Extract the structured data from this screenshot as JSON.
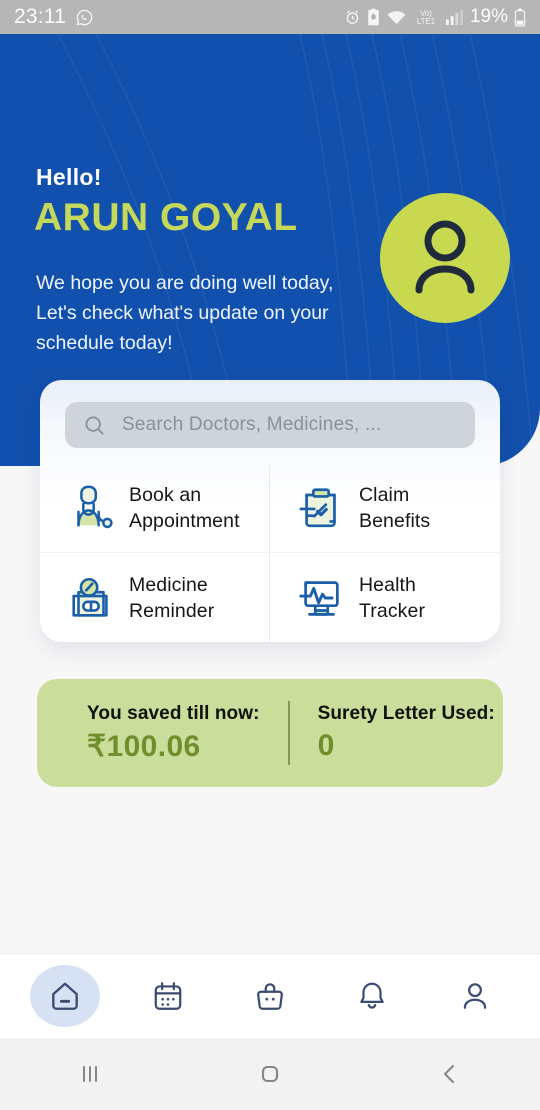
{
  "statusbar": {
    "time": "23:11",
    "battery_percent": "19%",
    "icons": [
      "whatsapp-icon",
      "alarm-icon",
      "battery-saver-icon",
      "wifi-icon",
      "volte-icon",
      "signal-icon",
      "battery-icon"
    ]
  },
  "header": {
    "greeting": "Hello!",
    "username": "ARUN GOYAL",
    "subtitle": "We hope you are doing well today, Let's check what's update on your schedule today!",
    "avatar_alt": "user-avatar",
    "bg_color": "#1250ad",
    "name_color": "#c5d85a",
    "avatar_color": "#c8d94f"
  },
  "search": {
    "placeholder": "Search Doctors, Medicines, ...",
    "value": ""
  },
  "quick_actions": [
    {
      "label": "Book an\nAppointment",
      "icon": "doctor-icon"
    },
    {
      "label": "Claim\nBenefits",
      "icon": "clipboard-check-icon"
    },
    {
      "label": "Medicine\nReminder",
      "icon": "medicine-clock-icon"
    },
    {
      "label": "Health\nTracker",
      "icon": "monitor-heartbeat-icon"
    }
  ],
  "savings": {
    "saved_label": "You saved till now:",
    "saved_value": "₹100.06",
    "surety_label": "Surety Letter Used:",
    "surety_value": "0",
    "card_color": "#cbdd9a",
    "value_color": "#6f8f2c"
  },
  "bottom_nav": [
    {
      "name": "home",
      "icon": "home-icon",
      "active": true
    },
    {
      "name": "calendar",
      "icon": "calendar-icon",
      "active": false
    },
    {
      "name": "orders",
      "icon": "bag-icon",
      "active": false
    },
    {
      "name": "notifications",
      "icon": "bell-icon",
      "active": false
    },
    {
      "name": "profile",
      "icon": "person-icon",
      "active": false
    }
  ],
  "system_nav": [
    {
      "name": "recents",
      "icon": "recents-icon"
    },
    {
      "name": "home",
      "icon": "home-square-icon"
    },
    {
      "name": "back",
      "icon": "back-chevron-icon"
    }
  ]
}
